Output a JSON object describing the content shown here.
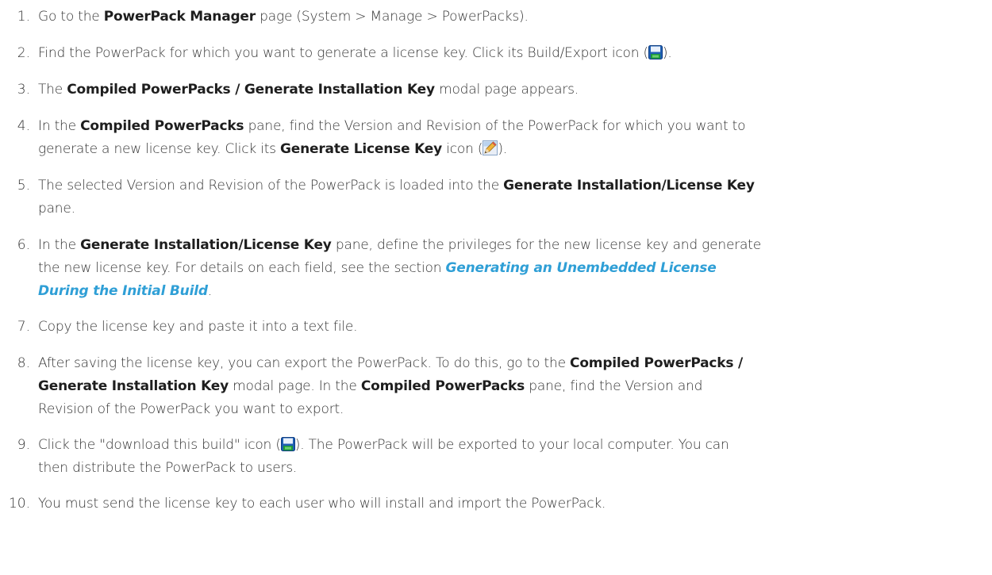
{
  "steps": [
    {
      "num": "1.",
      "parts": [
        {
          "t": "Go to the "
        },
        {
          "t": "PowerPack Manager",
          "b": true
        },
        {
          "t": " page (System > Manage > PowerPacks)."
        }
      ]
    },
    {
      "num": "2.",
      "parts": [
        {
          "t": "Find the PowerPack for which you want to generate a license key. Click its Build/Export icon ("
        },
        {
          "icon": "save-disk-icon"
        },
        {
          "t": ")."
        }
      ]
    },
    {
      "num": "3.",
      "parts": [
        {
          "t": "The "
        },
        {
          "t": "Compiled PowerPacks / Generate Installation Key",
          "b": true
        },
        {
          "t": " modal page appears."
        }
      ]
    },
    {
      "num": "4.",
      "parts": [
        {
          "t": "In the "
        },
        {
          "t": "Compiled PowerPacks",
          "b": true
        },
        {
          "t": " pane, find the Version and Revision of the PowerPack for which you want to"
        },
        {
          "br": true
        },
        {
          "t": "generate a new license key. Click its "
        },
        {
          "t": "Generate License Key",
          "b": true
        },
        {
          "t": " icon ("
        },
        {
          "icon": "pencil-edit-icon"
        },
        {
          "t": ")."
        }
      ]
    },
    {
      "num": "5.",
      "parts": [
        {
          "t": "The selected Version and Revision of the PowerPack is loaded into the "
        },
        {
          "t": "Generate Installation/License Key",
          "b": true
        },
        {
          "br": true
        },
        {
          "t": "pane."
        }
      ]
    },
    {
      "num": "6.",
      "parts": [
        {
          "t": "In the "
        },
        {
          "t": "Generate Installation/License Key",
          "b": true
        },
        {
          "t": " pane, define the privileges for the new license key and generate"
        },
        {
          "br": true
        },
        {
          "t": "the new license key. For details on each field, see the section "
        },
        {
          "t": "Generating an Unembedded License",
          "link": true
        },
        {
          "br": true
        },
        {
          "t": "During the Initial Build",
          "link": true
        },
        {
          "t": "."
        }
      ]
    },
    {
      "num": "7.",
      "parts": [
        {
          "t": "Copy the license key and paste it into a text file."
        }
      ]
    },
    {
      "num": "8.",
      "parts": [
        {
          "t": "After saving the license key, you can export the PowerPack. To do this, go to the "
        },
        {
          "t": "Compiled PowerPacks /",
          "b": true
        },
        {
          "br": true
        },
        {
          "t": "Generate Installation Key",
          "b": true
        },
        {
          "t": " modal page. In the "
        },
        {
          "t": "Compiled PowerPacks",
          "b": true
        },
        {
          "t": " pane, find the Version and"
        },
        {
          "br": true
        },
        {
          "t": "Revision of the PowerPack you want to export."
        }
      ]
    },
    {
      "num": "9.",
      "parts": [
        {
          "t": "Click the \"download this build\" icon ("
        },
        {
          "icon": "save-disk-icon"
        },
        {
          "t": "). The PowerPack will be exported to your local computer. You can"
        },
        {
          "br": true
        },
        {
          "t": "then distribute the PowerPack to users."
        }
      ]
    },
    {
      "num": "10.",
      "parts": [
        {
          "t": "You must send the license key to each user who will install and import the PowerPack."
        }
      ]
    }
  ]
}
